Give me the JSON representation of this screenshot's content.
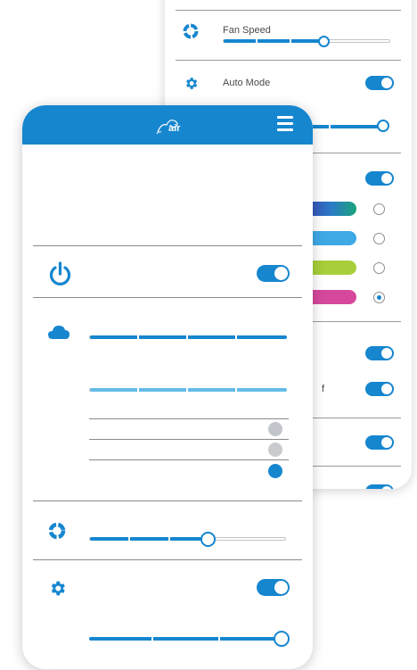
{
  "settings_panel": {
    "fan_speed": {
      "label": "Fan Speed",
      "level_percent": 60
    },
    "auto_mode": {
      "label": "Auto Mode",
      "enabled": true
    },
    "color_swatches": [
      "#3b4fb8",
      "#3fa9e6",
      "#a8cf3a",
      "#d6489c"
    ],
    "selected_swatch_index": 3,
    "partial_label": "f"
  },
  "app": {
    "logo_text": "air",
    "accent_color": "#1686cf"
  },
  "controls": {
    "power": {
      "enabled": true
    },
    "air_quality_bars": [
      100,
      100
    ],
    "indicator_dots": [
      "#c2c6cc",
      "#c9cbce",
      "#1686cf"
    ],
    "fan_speed_percent": 60,
    "auto_mode_enabled": true,
    "auto_level_percent": 100
  }
}
